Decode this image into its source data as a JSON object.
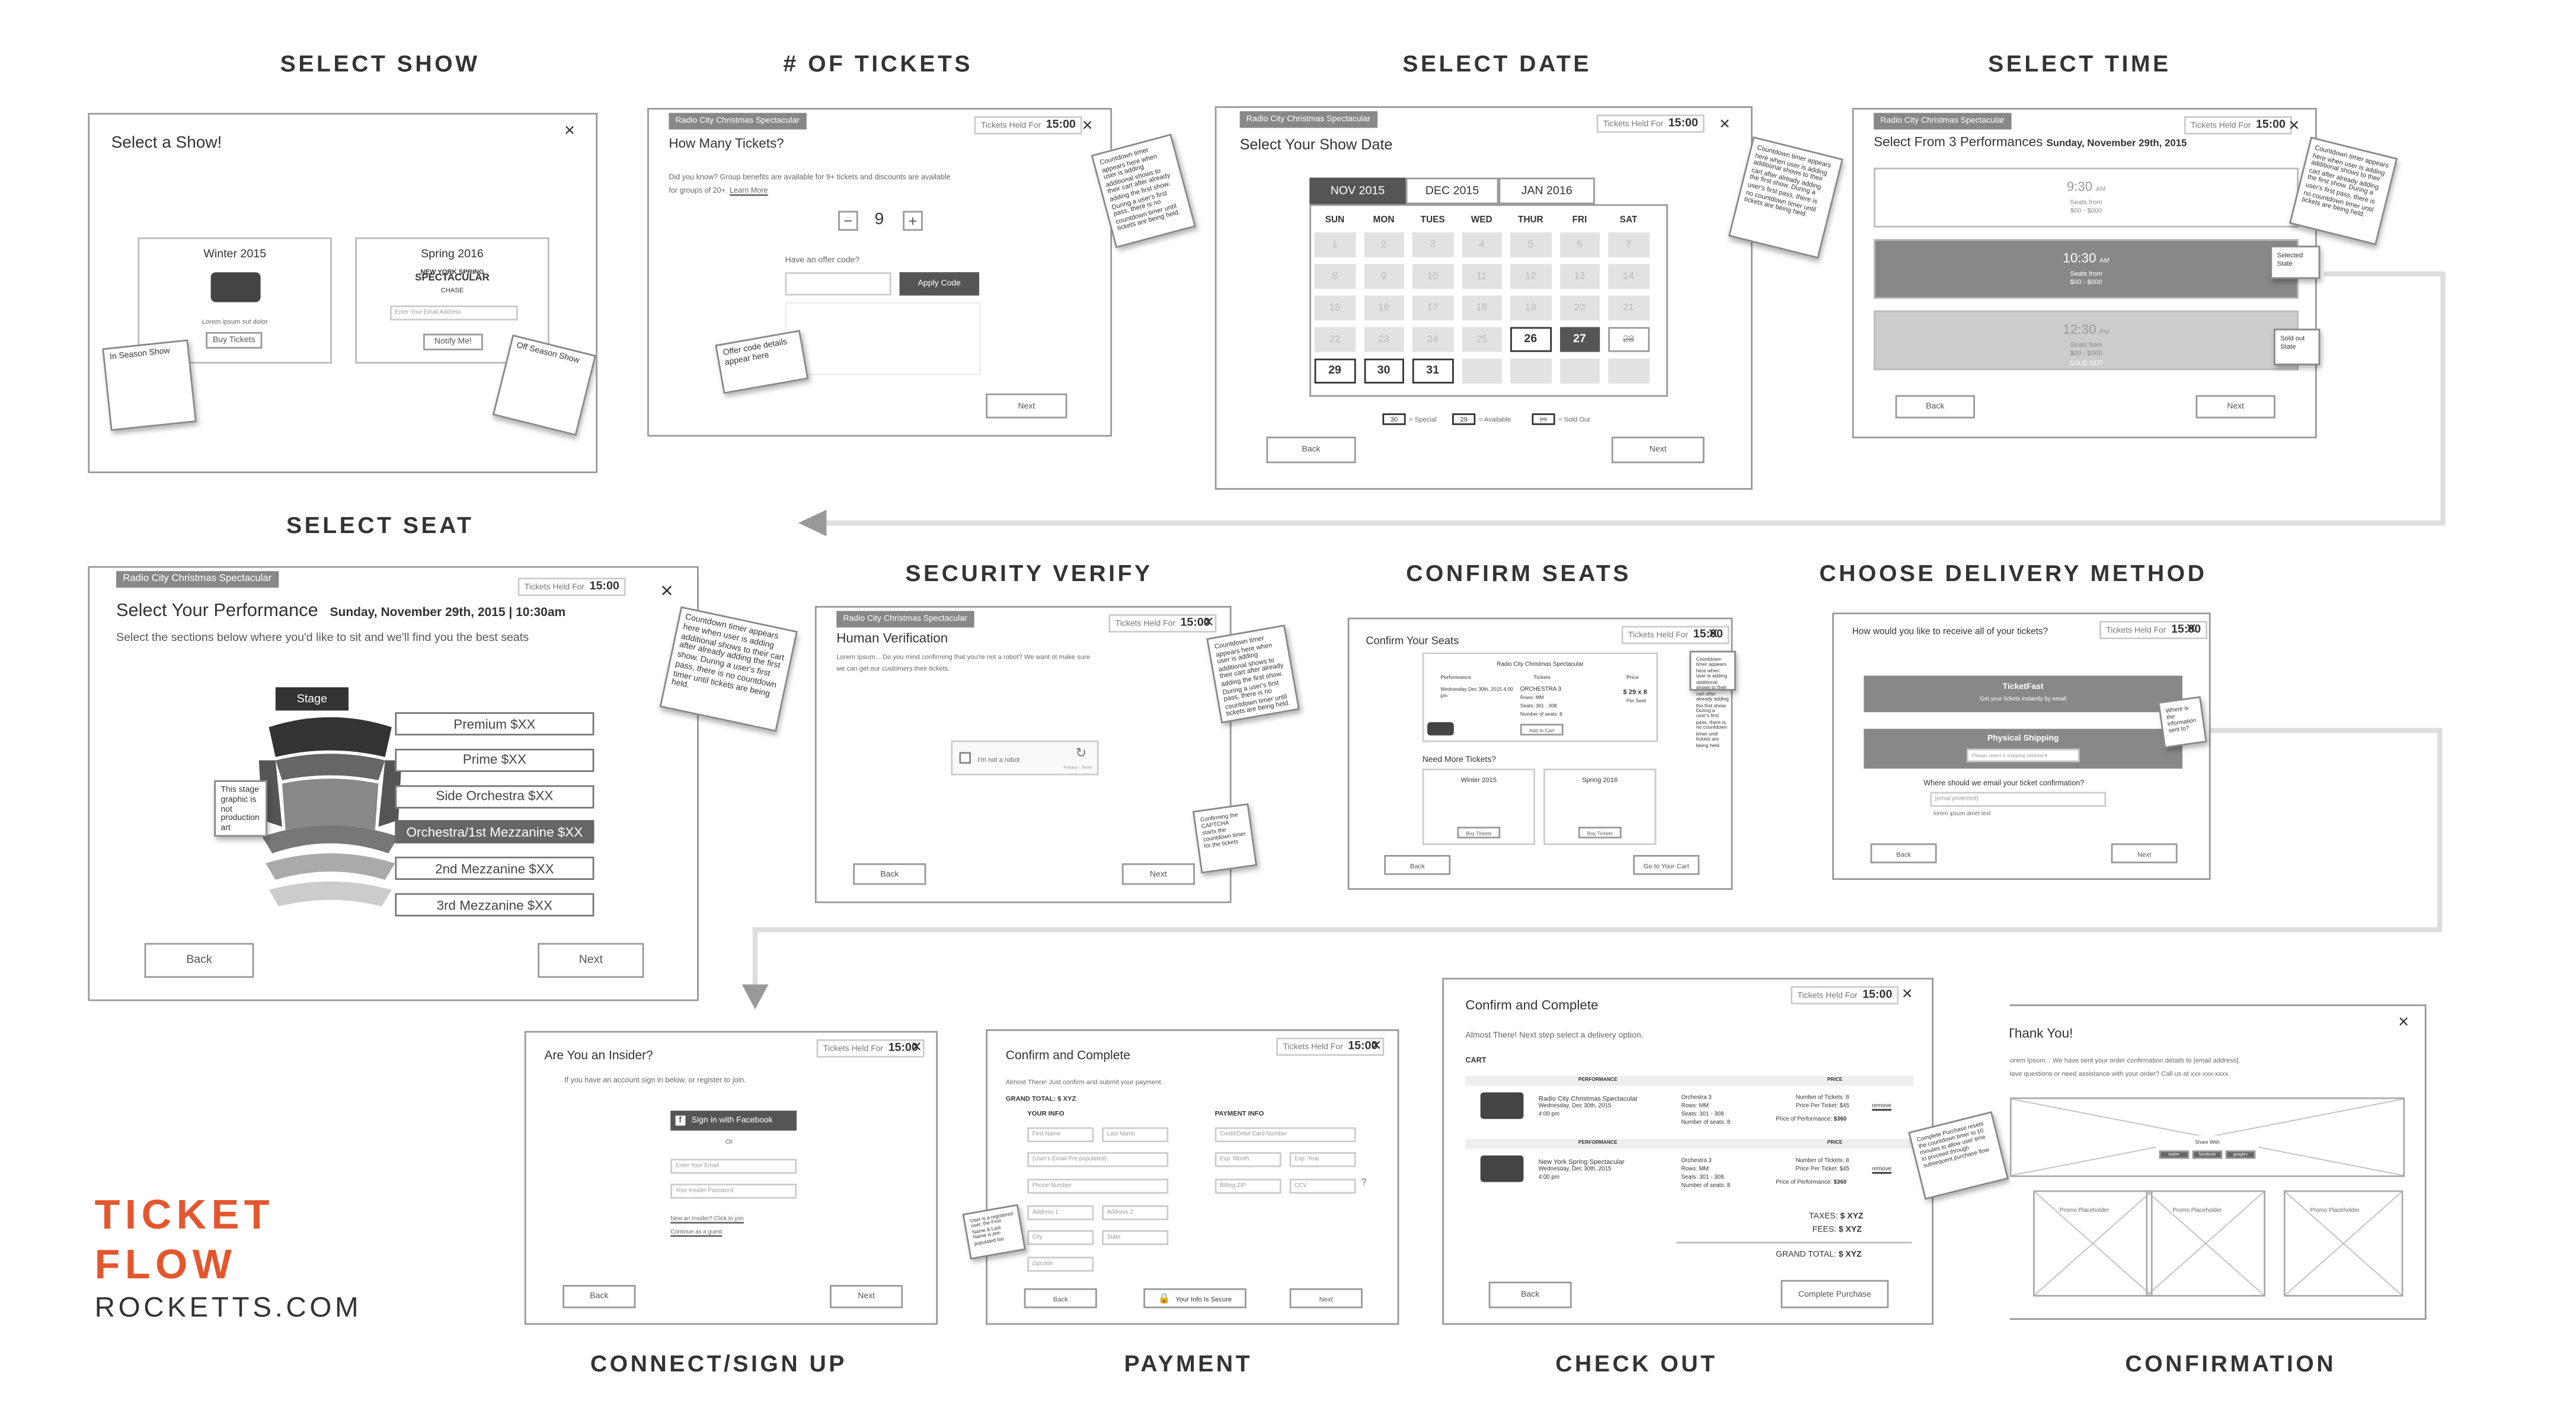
{
  "sections": {
    "select_show": "SELECT SHOW",
    "num_tickets": "# OF TICKETS",
    "select_date": "SELECT DATE",
    "select_time": "SELECT TIME",
    "select_seat": "SELECT SEAT",
    "security_verify": "SECURITY VERIFY",
    "confirm_seats": "CONFIRM SEATS",
    "delivery": "CHOOSE DELIVERY METHOD",
    "connect": "CONNECT/SIGN UP",
    "payment": "PAYMENT",
    "checkout": "CHECK OUT",
    "confirmation": "CONFIRMATION"
  },
  "brand": {
    "line1": "TICKET",
    "line2": "FLOW",
    "site": "ROCKETTS.COM",
    "color": "#e4572e"
  },
  "common": {
    "show": "Radio City Christmas Spectacular",
    "held_label": "Tickets Held For",
    "held_time": "15:00",
    "back": "Back",
    "next": "Next",
    "close": "×"
  },
  "notes": {
    "countdown": "Countdown timer appears here when user is adding additional shows to their cart after already adding the first show. During a user's first pass, there is no countdown timer until tickets are being held.",
    "in_season": "In Season Show",
    "off_season": "Off Season Show",
    "offer": "Offer code details appear here",
    "selected": "Selected State",
    "soldout": "Sold out State",
    "graphic": "This stage graphic is not production art",
    "captcha": "Confirming the CAPTCHA starts the countdown timer for the tickets",
    "where": "Where is the information sent to?",
    "registered": "User is a registered user, the First Name & Last Name is pre-populated too",
    "purchase": "Complete Purchase resets the countdown timer to 10 minutes to allow user time to proceed through subsequent purchase flow"
  },
  "show": {
    "title": "Select a Show!",
    "w_title": "Winter 2015",
    "w_lorem": "Lorem ipsum sut dolor",
    "w_btn": "Buy Tickets",
    "s_title": "Spring 2016",
    "s_logo1": "NEW YORK SPRING",
    "s_logo2": "SPECTACULAR",
    "s_logo3": "CHASE",
    "s_input": "Enter Your Email Address",
    "s_btn": "Notify Me!"
  },
  "tickets": {
    "title": "How Many Tickets?",
    "desc1": "Did you know? Group benefits are available for 9+ tickets and discounts are available",
    "desc2": "for groups of 20+.",
    "learn": "Learn More",
    "minus": "−",
    "count": "9",
    "plus": "+",
    "offer_q": "Have an offer code?",
    "apply": "Apply Code"
  },
  "date": {
    "title": "Select Your Show Date",
    "tabs": [
      "NOV 2015",
      "DEC 2015",
      "JAN 2016"
    ],
    "dow": [
      "SUN",
      "MON",
      "TUES",
      "WED",
      "THUR",
      "FRI",
      "SAT"
    ],
    "grid": [
      [
        "1",
        "2",
        "3",
        "4",
        "5",
        "6",
        "7"
      ],
      [
        "8",
        "9",
        "10",
        "11",
        "12",
        "13",
        "14"
      ],
      [
        "15",
        "16",
        "17",
        "18",
        "19",
        "20",
        "21"
      ],
      [
        "22",
        "23",
        "24",
        "25",
        "26",
        "27",
        "28"
      ],
      [
        "29",
        "30",
        "31",
        "",
        "",
        "",
        ""
      ]
    ],
    "legend": [
      "= Special",
      "= Available",
      "= Sold Out"
    ],
    "lk": [
      "30",
      "29",
      "29"
    ]
  },
  "time": {
    "title": "Select From 3 Performances",
    "date": "Sunday, November 29th, 2015",
    "slots": [
      {
        "time": "9:30",
        "ampm": "AM",
        "seats": "Seats from",
        "price": "$00 - $000",
        "status": ""
      },
      {
        "time": "10:30",
        "ampm": "AM",
        "seats": "Seats from",
        "price": "$00 - $000",
        "status": ""
      },
      {
        "time": "12:30",
        "ampm": "PM",
        "seats": "Seats from",
        "price": "$00 - $000",
        "status": "SOLD OUT"
      }
    ]
  },
  "seat": {
    "title": "Select Your Performance",
    "date": "Sunday, November 29th, 2015 | 10:30am",
    "desc": "Select the sections below where you'd like to sit and we'll find you the best seats",
    "stage": "Stage",
    "sections": [
      "Premium $XX",
      "Prime $XX",
      "Side Orchestra $XX",
      "Orchestra/1st Mezzanine $XX",
      "2nd Mezzanine $XX",
      "3rd Mezzanine $XX"
    ]
  },
  "security": {
    "title": "Human Verification",
    "desc1": "Lorem Ipsum... Do you mind confirming that you're not a robot? We want ot make sure",
    "desc2": "we can get our customers their tickets.",
    "robot": "I'm not a robot",
    "privacy": "Privacy - Terms"
  },
  "confirm": {
    "title": "Confirm Your Seats",
    "col": [
      "Performance",
      "Tickets",
      "Price"
    ],
    "perf": "Wednesday Dec 30th, 2015 4:00 pm",
    "orch": "ORCHESTRA 3",
    "rows": "Rows: MM",
    "seats": "Seats: 301 - 308",
    "num": "Number of seats: 8",
    "price": "$ 29 x 8",
    "per": "Per Seat",
    "add": "Add to Cart",
    "more": "Need More Tickets?",
    "w": "Winter 2015",
    "s": "Spring 2016",
    "buy": "Buy Tickets",
    "goto": "Go to Your Cart"
  },
  "delivery": {
    "title": "How would you like to receive all of your tickets?",
    "tf": "TicketFast",
    "tf_sub": "Get your tickets instantly by email",
    "ps": "Physical Shipping",
    "ps_sub": "Please select a shipping method",
    "email_q": "Where should we email your ticket confirmation?",
    "email": "[email protected]",
    "lorem": "lorem ipsum amet text"
  },
  "connect": {
    "title": "Are You an Insider?",
    "desc": "If you have an account sign in below, or register to join.",
    "fb": "Sign in with Facebook",
    "or": "Or",
    "email": "Enter Your Email",
    "pass": "Your Insider Password",
    "new": "New an Insider? Click to join",
    "guest": "Continue as a guest"
  },
  "payment": {
    "title": "Confirm and Complete",
    "desc": "Almost There! Just confirm and submit your payment.",
    "total": "GRAND TOTAL:",
    "total_v": "$ XYZ",
    "your": "YOUR INFO",
    "pinfo": "PAYMENT INFO",
    "f": [
      "First Name",
      "Last Name",
      "(User's Email Pre-populated)",
      "Phone Number",
      "Address 1",
      "Address 2",
      "City",
      "State",
      "Zipcode"
    ],
    "p": [
      "Credit/Debit Card Number",
      "Exp. Month",
      "Exp. Year",
      "Billing ZIP",
      "CCV"
    ],
    "secure": "Your Info Is Secure"
  },
  "checkout": {
    "title": "Confirm and Complete",
    "desc": "Almost There! Next step select a delivery option.",
    "cart": "CART",
    "perf": "PERFORMANCE",
    "price": "PRICE",
    "items": [
      {
        "name": "Radio City Christmas Spectacular",
        "date": "Wednesday, Dec 30th, 2015",
        "time": "4:00 pm",
        "orch": "Orchestra 3",
        "rows": "Rows: MM",
        "seats": "Seats: 301 - 308",
        "num": "Number of seats: 8",
        "n": "Number of Tickets: 8",
        "ppt": "Price Per Ticket: $45",
        "pop": "Price of Performance:",
        "pv": "$360",
        "rm": "remove"
      },
      {
        "name": "New York Spring Spectacular",
        "date": "Wednesday, Dec 30th, 2015",
        "time": "4:00 pm",
        "orch": "Orchestra 3",
        "rows": "Rows: MM",
        "seats": "Seats: 301 - 308",
        "num": "Number of seats: 8",
        "n": "Number of Tickets: 8",
        "ppt": "Price Per Ticket: $45",
        "pop": "Price of Performance:",
        "pv": "$360",
        "rm": "remove"
      }
    ],
    "taxes": "TAXES:",
    "fees": "FEES:",
    "grand": "GRAND TOTAL:",
    "v": "$ XYZ",
    "complete": "Complete Purchase"
  },
  "confirmation": {
    "title": "Thank You!",
    "l1": "Lorem Ipsum... We have sent your order confirmation details to [email address].",
    "l2": "Have questions or need assistance with your order? Call us at xxx-xxx-xxxx.",
    "share": "Share With",
    "soc": [
      "twitter",
      "facebook",
      "google+"
    ],
    "promo": "Promo Placeholder"
  }
}
